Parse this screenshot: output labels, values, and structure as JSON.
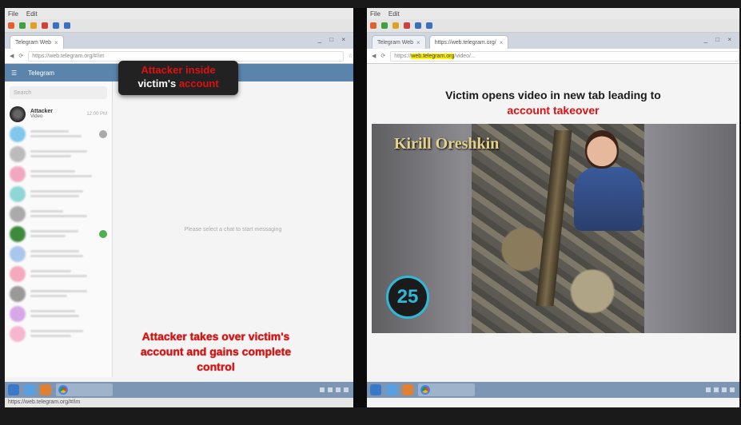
{
  "left_browser": {
    "menu": [
      "File",
      "Edit"
    ],
    "tabs": [
      {
        "label": "Telegram Web"
      }
    ],
    "url": "https://web.telegram.org/#/im",
    "app_title": "Telegram",
    "search_placeholder": "Search",
    "chats": [
      {
        "name": "Attacker",
        "subtitle": "Video",
        "time": "12:00 PM"
      }
    ],
    "empty_state": "Please select a chat to start messaging",
    "status_text": "https://web.telegram.org/#/im"
  },
  "overlays": {
    "inside_line1": "Attacker inside",
    "inside_line2_prefix": "victim's ",
    "inside_line2_red": "account",
    "takeover_caption_1": "Attacker takes over victim's",
    "takeover_caption_2": "account and gains complete",
    "takeover_caption_3": "control"
  },
  "right_browser": {
    "menu": [
      "File",
      "Edit"
    ],
    "tabs": [
      {
        "label": "Telegram Web"
      },
      {
        "label": "https://web.telegram.org/"
      }
    ],
    "url_prefix": "https://",
    "url_highlight": "web.telegram.org",
    "url_suffix": "/video/...",
    "title_line1": "Victim opens video in new tab leading to",
    "title_line2": "account takeover",
    "video_title": "Kirill Oreshkin",
    "video_badge": "25"
  },
  "colors": {
    "accent_red": "#e01010",
    "telegram_header": "#5b84ad",
    "badge_ring": "#2fb8d8",
    "url_highlight": "#fff200"
  }
}
